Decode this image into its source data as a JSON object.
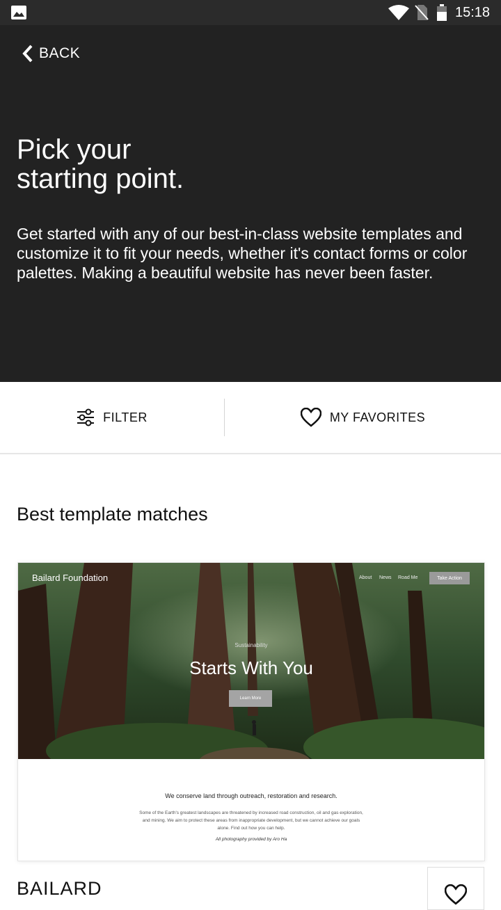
{
  "status_bar": {
    "time": "15:18"
  },
  "header": {
    "back_label": "BACK",
    "title": "Pick your\nstarting point.",
    "description": "Get started with any of our best-in-class website templates and customize it to fit your needs, whether it's contact forms or color palettes. Making a beautiful website has never been faster."
  },
  "toolbar": {
    "filter_label": "FILTER",
    "favorites_label": "MY FAVORITES"
  },
  "section": {
    "title": "Best template matches"
  },
  "template_preview": {
    "site_name": "Bailard Foundation",
    "nav": [
      "About",
      "News",
      "Road Me"
    ],
    "cta": "Take Action",
    "kicker": "Sustainability",
    "headline": "Starts With You",
    "button": "Learn More",
    "mission": "We conserve land through outreach, restoration and research.",
    "description": "Some of the Earth's greatest landscapes are threatened by increased road construction, oil and gas exploration, and mining. We aim to protect these areas from inappropriate development, but we cannot achieve our goals alone. Find out how you can help.",
    "credit": "All photography provided by Aro Ha"
  },
  "template": {
    "name": "BAILARD"
  },
  "colors": {
    "header_bg": "#222222",
    "status_bg": "#2b2b2b",
    "text": "#111111"
  }
}
